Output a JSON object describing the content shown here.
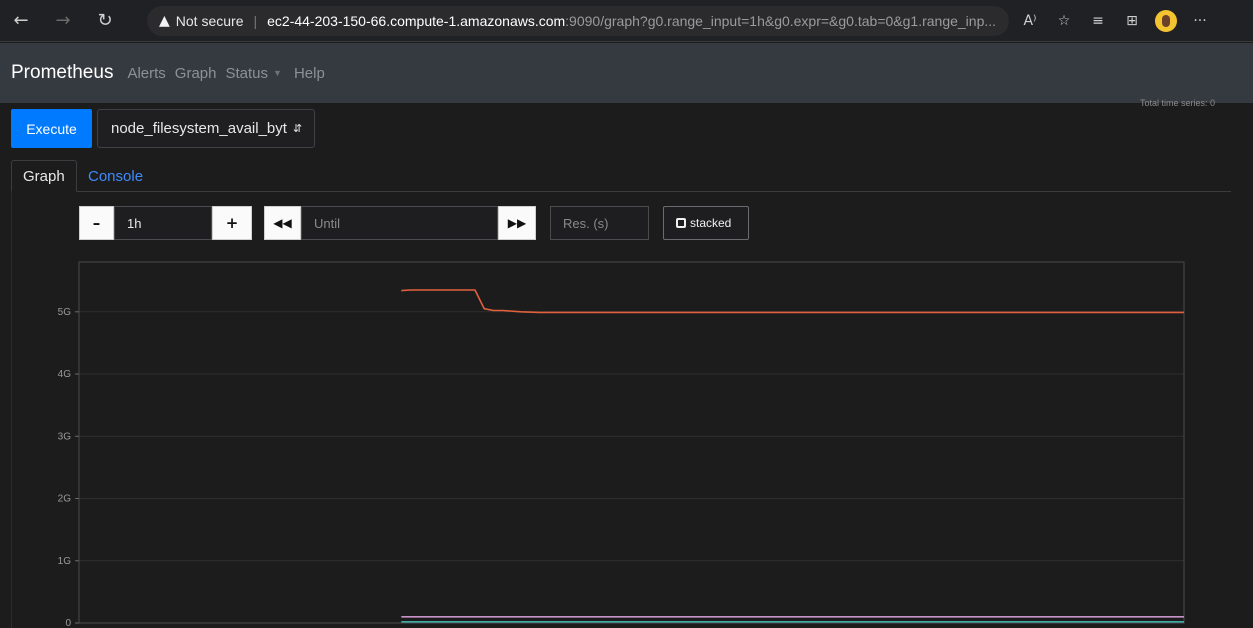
{
  "browser": {
    "back_icon": "arrow-left-icon",
    "forward_icon": "arrow-right-icon",
    "refresh_icon": "refresh-icon",
    "security_label": "Not secure",
    "url_host": "ec2-44-203-150-66.compute-1.amazonaws.com",
    "url_path": ":9090/graph?g0.range_input=1h&g0.expr=&g0.tab=0&g1.range_inp...",
    "read_aloud_icon": "read-aloud-icon",
    "favorite_icon": "add-favorite-icon",
    "favorites_icon": "favorites-icon",
    "collections_icon": "collections-icon",
    "profile_icon": "profile-avatar-icon",
    "more_icon": "more-icon",
    "read_aloud_text": "A⁾",
    "more_text": "···"
  },
  "navbar": {
    "brand": "Prometheus",
    "links": [
      "Alerts",
      "Graph",
      "Status",
      "Help"
    ]
  },
  "top_right_note": "Total time series: 0",
  "query": {
    "execute_label": "Execute",
    "expression": "node_filesystem_avail_byt"
  },
  "tabs": {
    "graph": "Graph",
    "console": "Console"
  },
  "controls": {
    "range_value": "1h",
    "until_placeholder": "Until",
    "res_placeholder": "Res. (s)",
    "stacked_label": "stacked"
  },
  "colors": {
    "accent": "#007bff",
    "link": "#3d8bfd",
    "series_orange": "#e1613c",
    "series_purple": "#c792c9",
    "series_teal": "#3fa9a4"
  },
  "chart_data": {
    "type": "line",
    "ylim": [
      0,
      5.8
    ],
    "y_ticks": [
      "0",
      "1G",
      "2G",
      "3G",
      "4G",
      "5G"
    ],
    "y_tick_values": [
      0,
      1,
      2,
      3,
      4,
      5
    ],
    "xlim": [
      0,
      60
    ],
    "grid": true,
    "series": [
      {
        "color": "#e1613c",
        "x": [
          17.5,
          18,
          20,
          21.5,
          22,
          22.5,
          23,
          24,
          25,
          26,
          60
        ],
        "y": [
          5.34,
          5.35,
          5.35,
          5.35,
          5.05,
          5.02,
          5.02,
          5.0,
          4.99,
          4.99,
          4.99
        ]
      },
      {
        "color": "#c792c9",
        "x": [
          17.5,
          60
        ],
        "y": [
          0.1,
          0.1
        ]
      },
      {
        "color": "#3fa9a4",
        "x": [
          17.5,
          20,
          60
        ],
        "y": [
          0.02,
          0.02,
          0.02
        ]
      }
    ]
  }
}
